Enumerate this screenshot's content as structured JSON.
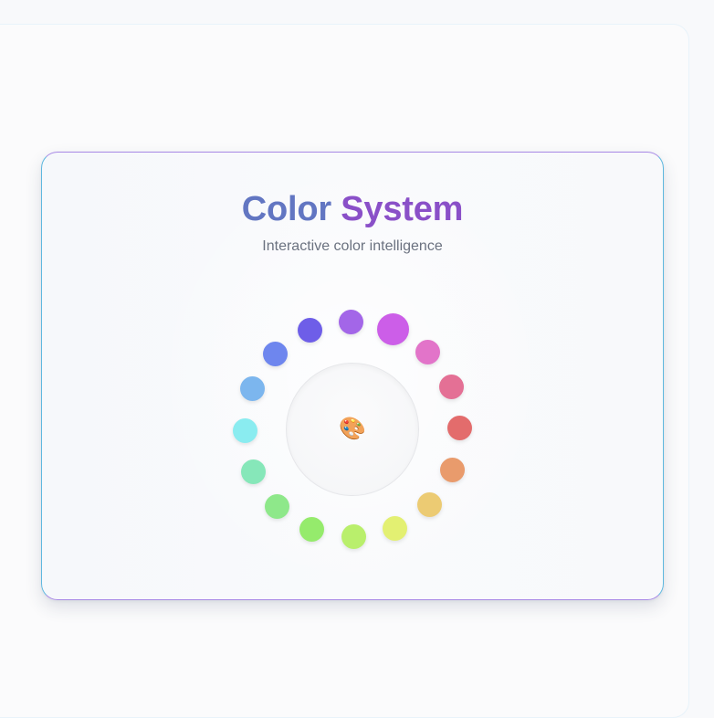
{
  "header": {
    "title_part1": "Color",
    "title_part2": "System",
    "subtitle": "Interactive color intelligence"
  },
  "center": {
    "icon": "palette-icon",
    "glyph": "🎨"
  },
  "swatches": [
    {
      "id": "magenta",
      "color": "#cc5ee8",
      "selected": true
    },
    {
      "id": "pink",
      "color": "#e274c9"
    },
    {
      "id": "rose",
      "color": "#e47095"
    },
    {
      "id": "red",
      "color": "#e36c6c"
    },
    {
      "id": "orange",
      "color": "#e99b6c"
    },
    {
      "id": "amber",
      "color": "#eccb73"
    },
    {
      "id": "lime-yellow",
      "color": "#e3f072"
    },
    {
      "id": "lime",
      "color": "#b9ef6c"
    },
    {
      "id": "green",
      "color": "#95eb6c"
    },
    {
      "id": "mint-green",
      "color": "#8ee88a"
    },
    {
      "id": "mint",
      "color": "#86e7b9"
    },
    {
      "id": "cyan",
      "color": "#8aecf0"
    },
    {
      "id": "sky",
      "color": "#7cb6ee"
    },
    {
      "id": "blue",
      "color": "#6e86ee"
    },
    {
      "id": "indigo",
      "color": "#6e5ee8"
    },
    {
      "id": "violet",
      "color": "#a366e8"
    }
  ]
}
